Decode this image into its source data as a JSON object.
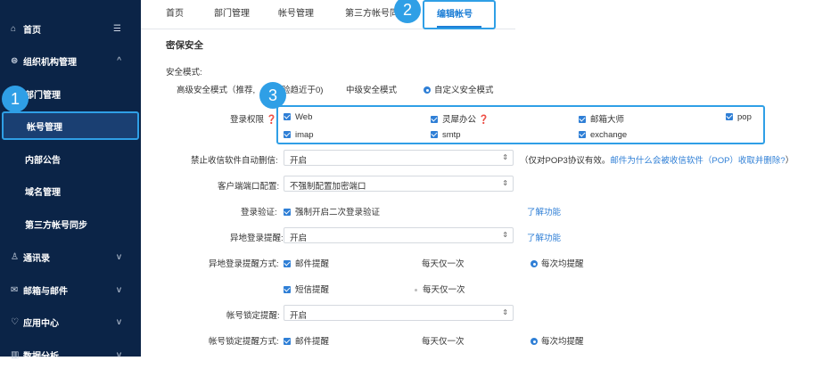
{
  "sidebar": {
    "items": [
      {
        "label": "首页",
        "icon": "home-icon",
        "right": "☰"
      },
      {
        "label": "组织机构管理",
        "icon": "org-icon",
        "right": "^"
      },
      {
        "label": "部门管理"
      },
      {
        "label": "帐号管理"
      },
      {
        "label": "内部公告"
      },
      {
        "label": "域名管理"
      },
      {
        "label": "第三方帐号同步"
      },
      {
        "label": "通讯录",
        "icon": "contacts-icon",
        "right": "v"
      },
      {
        "label": "邮箱与邮件",
        "icon": "mail-icon",
        "right": "v"
      },
      {
        "label": "应用中心",
        "icon": "app-icon",
        "right": "v"
      },
      {
        "label": "数据分析",
        "icon": "chart-icon",
        "right": "v"
      }
    ]
  },
  "callouts": {
    "one": "1",
    "two": "2",
    "three": "3"
  },
  "tabs": {
    "t1": "首页",
    "t2": "部门管理",
    "t3": "帐号管理",
    "t4": "第三方帐号同",
    "active": "编辑帐号"
  },
  "section_title": "密保安全",
  "security_mode": {
    "label": "安全模式:",
    "high": "高级安全模式（推荐,",
    "high_tail": "验趋近于0)",
    "medium": "中级安全模式",
    "custom": "自定义安全模式"
  },
  "login_perm": {
    "label": "登录权限",
    "options": [
      "Web",
      "灵犀办公",
      "邮箱大师",
      "pop",
      "imap",
      "smtp",
      "exchange"
    ]
  },
  "auto_delete": {
    "label": "禁止收信软件自动删信:",
    "value": "开启",
    "hint": "（仅对POP3协议有效。",
    "hint_link": "邮件为什么会被收信软件（POP）收取并删除?",
    "hint_end": "）"
  },
  "client_port": {
    "label": "客户端端口配置:",
    "value": "不强制配置加密端口"
  },
  "login_verify": {
    "label": "登录验证:",
    "option": "强制开启二次登录验证",
    "link": "了解功能"
  },
  "remote_login": {
    "label": "异地登录提醒:",
    "value": "开启",
    "link": "了解功能"
  },
  "remote_method": {
    "label": "异地登录提醒方式:",
    "row1": [
      "邮件提醒",
      "每天仅一次",
      "每次均提醒"
    ],
    "row2": [
      "短信提醒",
      "每天仅一次"
    ]
  },
  "lock_alert": {
    "label": "帐号锁定提醒:",
    "value": "开启"
  },
  "lock_method": {
    "label": "帐号锁定提醒方式:",
    "row1": [
      "邮件提醒",
      "每天仅一次",
      "每次均提醒"
    ]
  },
  "colors": {
    "sidebar": "#0b2447",
    "accent": "#2f9fe6",
    "link": "#2f7fd6"
  }
}
